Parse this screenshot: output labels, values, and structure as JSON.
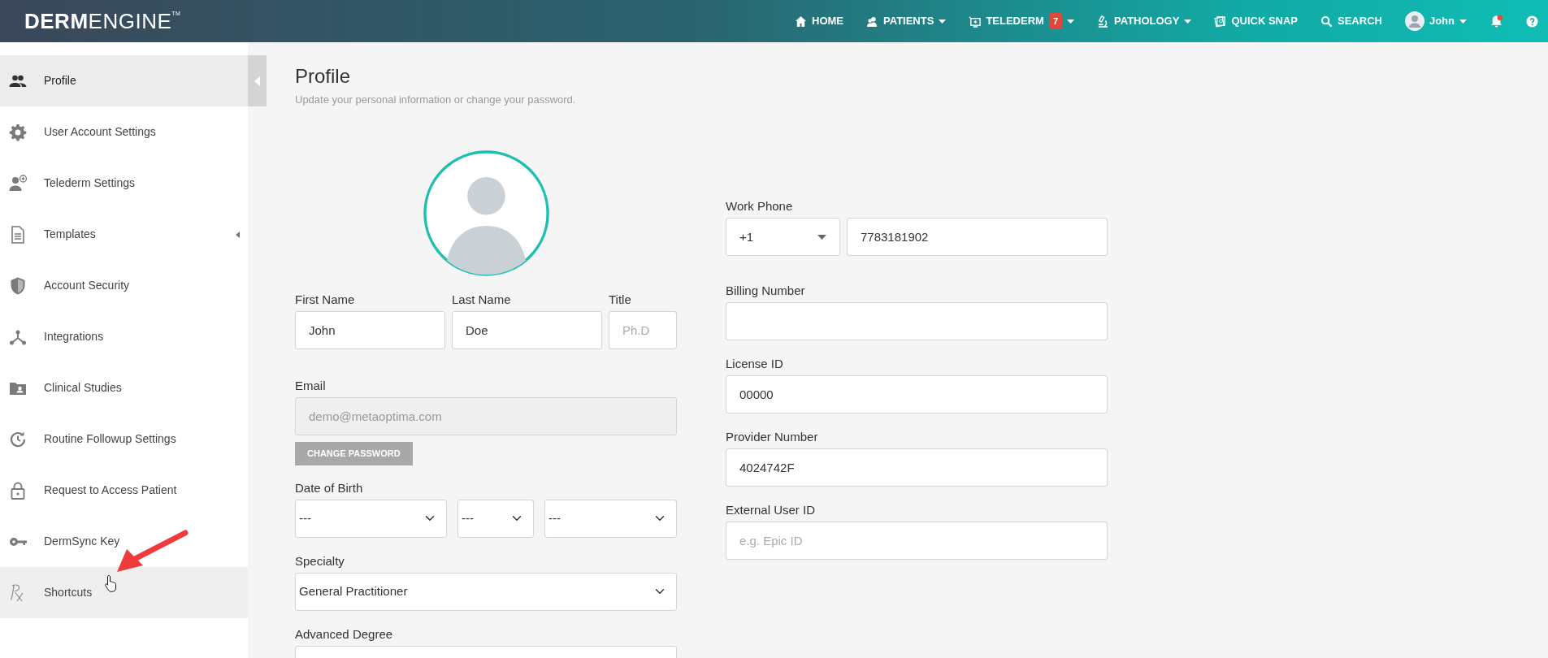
{
  "navbar": {
    "logo": "**DERM**ENGINE$^{TM}$",
    "items": [
      {
        "kind": "link",
        "label": "HOME",
        "dropdown": false
      },
      {
        "kind": "link",
        "label": "PATIENTS",
        "dropdown": true
      },
      {
        "kind": "link",
        "label": "TELEDERM",
        "badge": "7",
        "dropdown": true
      },
      {
        "kind": "link",
        "label": "PATHOLOGY",
        "dropdown": true
      },
      {
        "kind": "link",
        "label": "QUICK SNAP",
        "dropdown": false
      },
      {
        "kind": "link",
        "label": "SEARCH",
        "dropdown": false
      },
      {
        "kind": "user",
        "label": "John",
        "dropdown": true
      },
      {
        "kind": "bell",
        "alert": true
      },
      {
        "kind": "help"
      }
    ]
  },
  "sidebar": {
    "items": [
      {
        "label": "Profile",
        "selected": true,
        "hovered": false,
        "submenu": false
      },
      {
        "label": "User Account Settings",
        "selected": false,
        "hovered": false,
        "submenu": false
      },
      {
        "label": "Telederm Settings",
        "selected": false,
        "hovered": false,
        "submenu": false
      },
      {
        "label": "Templates",
        "selected": false,
        "hovered": false,
        "submenu": true
      },
      {
        "label": "Account Security",
        "selected": false,
        "hovered": false,
        "submenu": false
      },
      {
        "label": "Integrations",
        "selected": false,
        "hovered": false,
        "submenu": false
      },
      {
        "label": "Clinical Studies",
        "selected": false,
        "hovered": false,
        "submenu": false
      },
      {
        "label": "Routine Followup Settings",
        "selected": false,
        "hovered": false,
        "submenu": false
      },
      {
        "label": "Request to Access Patient",
        "selected": false,
        "hovered": false,
        "submenu": false
      },
      {
        "label": "DermSync Key",
        "selected": false,
        "hovered": false,
        "submenu": false
      },
      {
        "label": "Shortcuts",
        "selected": false,
        "hovered": true,
        "submenu": false
      }
    ]
  },
  "page": {
    "title": "Profile",
    "subtitle": "Update your personal information or change your password."
  },
  "form": {
    "left": [
      {
        "fields": [
          {
            "label": "First Name",
            "kind": "text",
            "value": "John"
          },
          {
            "label": "Last Name",
            "kind": "text",
            "value": "Doe"
          },
          {
            "label": "Title",
            "kind": "text",
            "placeholder": "Ph.D"
          }
        ]
      },
      {
        "label": "Email",
        "fields": [
          {
            "kind": "text",
            "value": "demo@metaoptima.com",
            "disabled": true
          }
        ],
        "button": {
          "label": "CHANGE PASSWORD",
          "disabled": true
        }
      },
      {
        "label": "Date of Birth",
        "fields": [
          {
            "kind": "select",
            "value": "---"
          },
          {
            "kind": "select",
            "value": "---"
          },
          {
            "kind": "select",
            "value": "---"
          }
        ]
      },
      {
        "label": "Specialty",
        "fields": [
          {
            "kind": "select",
            "value": "General Practitioner"
          }
        ]
      },
      {
        "label": "Advanced Degree",
        "fields": [
          {
            "kind": "text"
          }
        ]
      }
    ],
    "right": [
      {
        "label": "Work Phone",
        "fields": [
          {
            "kind": "dropdown",
            "value": "+1"
          },
          {
            "kind": "text",
            "value": "7783181902"
          }
        ]
      },
      {
        "label": "Billing Number",
        "fields": [
          {
            "kind": "text"
          }
        ]
      },
      {
        "label": "License ID",
        "fields": [
          {
            "kind": "text",
            "value": "00000"
          }
        ]
      },
      {
        "label": "Provider Number",
        "fields": [
          {
            "kind": "text",
            "value": "4024742F"
          }
        ]
      },
      {
        "label": "External User ID",
        "fields": [
          {
            "kind": "text",
            "placeholder": "e.g. Epic ID"
          }
        ]
      }
    ]
  }
}
